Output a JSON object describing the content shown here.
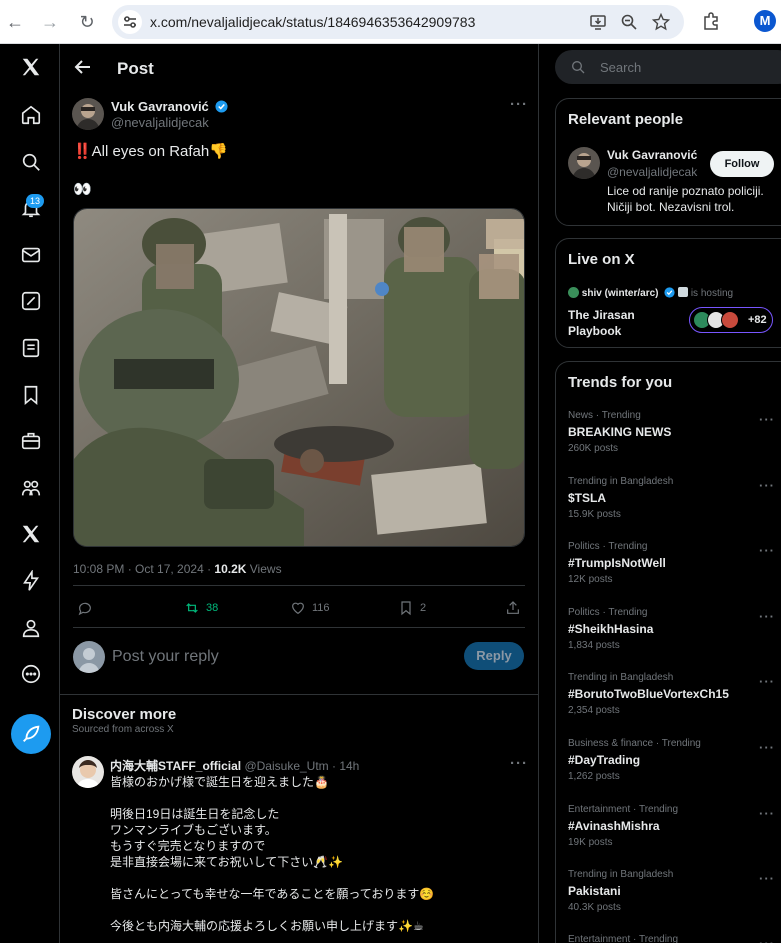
{
  "browser": {
    "url": "x.com/nevaljalidjecak/status/1846946353642909783",
    "profile_initial": "M"
  },
  "nav": {
    "notifications_badge": "13"
  },
  "header": {
    "title": "Post"
  },
  "post": {
    "author_name": "Vuk Gavranović",
    "author_handle": "@nevaljalidjecak",
    "text": "‼️All eyes on Rafah👎",
    "text2": "👀",
    "timestamp": "10:08 PM · Oct 17, 2024 · ",
    "views_count": "10.2K",
    "views_label": " Views",
    "reposts": "38",
    "likes": "116",
    "bookmarks": "2",
    "reply_placeholder": "Post your reply",
    "reply_button": "Reply"
  },
  "discover": {
    "title": "Discover more",
    "subtitle": "Sourced from across X",
    "post": {
      "author_name": "内海大輔STAFF_official",
      "author_meta": " @Daisuke_Utm · 14h",
      "lines": [
        "皆様のおかげ様で誕生日を迎えました🎂",
        "",
        "明後日19日は誕生日を記念した",
        "ワンマンライブもございます。",
        "もうすぐ完売となりますので",
        "是非直接会場に来てお祝いして下さい🥂✨",
        "",
        "皆さんにとっても幸せな一年であることを願っております☺️",
        "",
        "今後とも内海大輔の応援よろしくお願い申し上げます✨☕"
      ]
    }
  },
  "search": {
    "placeholder": "Search"
  },
  "relevant": {
    "title": "Relevant people",
    "name": "Vuk Gavranović",
    "handle": "@nevaljalidjecak",
    "follow": "Follow",
    "bio": "Lice od ranije poznato policiji. Ničiji bot. Nezavisni trol."
  },
  "live": {
    "title": "Live on X",
    "host": "shiv (winter/arc)",
    "hosting_label": "is hosting",
    "space_title": "The Jirasan Playbook",
    "listeners_extra": "+82"
  },
  "trends": {
    "title": "Trends for you",
    "items": [
      {
        "context": "News · Trending",
        "name": "BREAKING NEWS",
        "count": "260K posts"
      },
      {
        "context": "Trending in Bangladesh",
        "name": "$TSLA",
        "count": "15.9K posts"
      },
      {
        "context": "Politics · Trending",
        "name": "#TrumpIsNotWell",
        "count": "12K posts"
      },
      {
        "context": "Politics · Trending",
        "name": "#SheikhHasina",
        "count": "1,834 posts"
      },
      {
        "context": "Trending in Bangladesh",
        "name": "#BorutoTwoBlueVortexCh15",
        "count": "2,354 posts"
      },
      {
        "context": "Business & finance · Trending",
        "name": "#DayTrading",
        "count": "1,262 posts"
      },
      {
        "context": "Entertainment · Trending",
        "name": "#AvinashMishra",
        "count": "19K posts"
      },
      {
        "context": "Trending in Bangladesh",
        "name": "Pakistani",
        "count": "40.3K posts"
      },
      {
        "context": "Entertainment · Trending",
        "name": "",
        "count": ""
      }
    ]
  },
  "colors": {
    "accent": "#1d9bf0",
    "repost_active": "#00ba7c",
    "border": "#2f3336",
    "muted": "#71767b"
  }
}
